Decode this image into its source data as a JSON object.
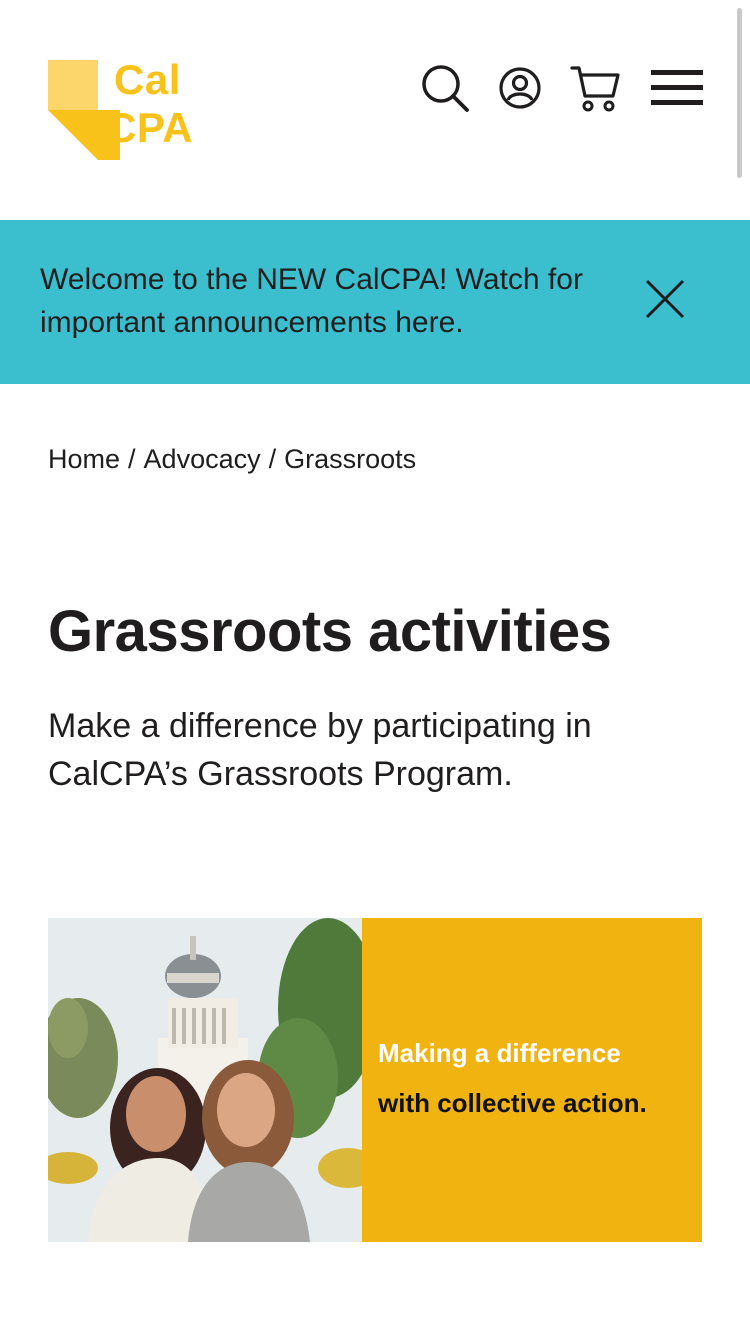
{
  "header": {
    "logo_line1": "Cal",
    "logo_line2": "CPA",
    "icons": [
      "search-icon",
      "account-icon",
      "cart-icon",
      "menu-icon"
    ]
  },
  "banner": {
    "text": "Welcome to the NEW CalCPA! Watch for important announcements here.",
    "close_icon": "close-icon"
  },
  "breadcrumb": {
    "items": [
      "Home",
      "Advocacy",
      "Grassroots"
    ],
    "separator": "/"
  },
  "main": {
    "title": "Grassroots activities",
    "subtitle": "Make a difference by participating in CalCPA’s Grassroots Program."
  },
  "hero": {
    "line1": "Making a difference",
    "line2": "with collective action."
  },
  "colors": {
    "brand_yellow": "#f9c21a",
    "banner_teal": "#3bbfcf",
    "hero_gold": "#f0b310",
    "text_dark": "#1f1d1e"
  }
}
